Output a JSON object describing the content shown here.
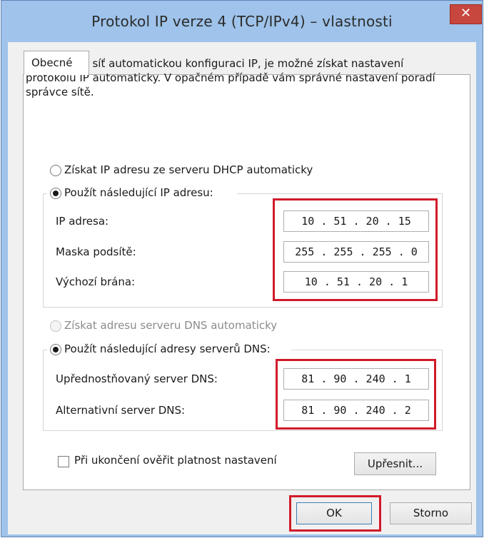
{
  "window": {
    "title": "Protokol IP verze 4 (TCP/IPv4) – vlastnosti",
    "close_glyph": "✕"
  },
  "tab": {
    "label": "Obecné"
  },
  "intro_text": "Podporuje-li síť automatickou konfiguraci IP, je možné získat nastavení protokolu IP automaticky. V opačném případě vám správné nastavení poradí správce sítě.",
  "ip_section": {
    "auto_option": "Získat IP adresu ze serveru DHCP automaticky",
    "manual_option": "Použít následující IP adresu:",
    "selected": "manual",
    "fields": {
      "ip_label": "IP adresa:",
      "ip_value": "10 . 51 . 20 . 15",
      "mask_label": "Maska podsítě:",
      "mask_value": "255 . 255 . 255 . 0",
      "gateway_label": "Výchozí brána:",
      "gateway_value": "10 . 51 . 20 . 1"
    }
  },
  "dns_section": {
    "auto_option": "Získat adresu serveru DNS automaticky",
    "manual_option": "Použít následující adresy serverů DNS:",
    "selected": "manual",
    "fields": {
      "preferred_label": "Upřednostňovaný server DNS:",
      "preferred_value": "81 . 90 . 240 . 1",
      "alternate_label": "Alternativní server DNS:",
      "alternate_value": "81 . 90 . 240 . 2"
    }
  },
  "validate_checkbox": {
    "label": "Při ukončení ověřit platnost nastavení",
    "checked": false
  },
  "buttons": {
    "advanced": "Upřesnit...",
    "ok": "OK",
    "cancel": "Storno"
  },
  "annotation_color": "#d11a2a"
}
